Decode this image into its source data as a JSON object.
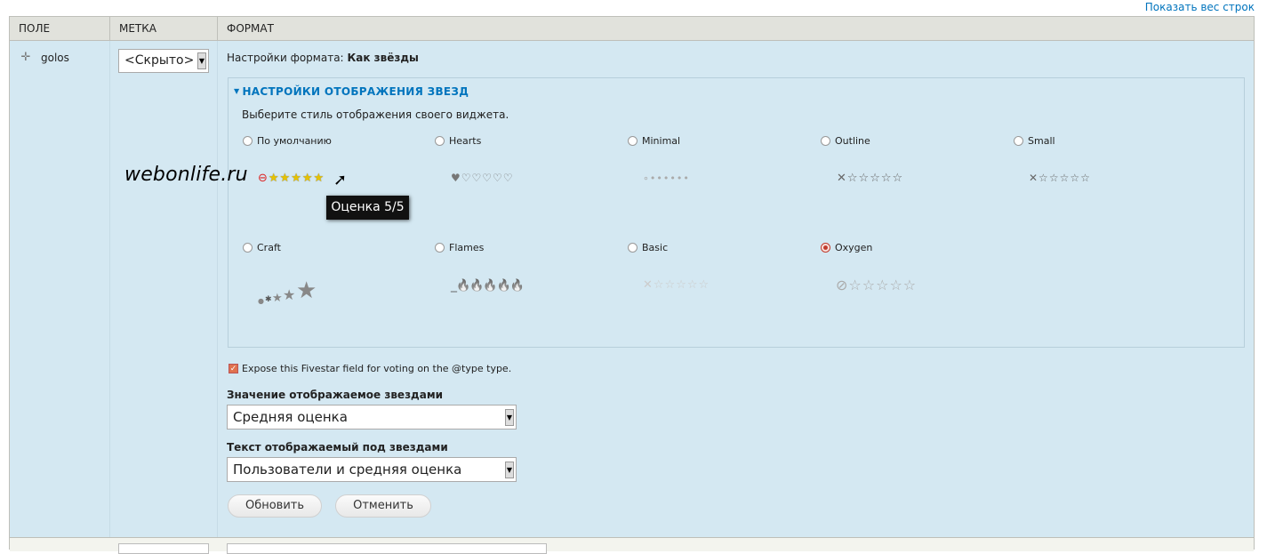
{
  "top_link": "Показать вес строк",
  "columns": [
    "Поле",
    "Метка",
    "Формат"
  ],
  "row": {
    "field": "golos",
    "label_select": "<Скрыто>",
    "format_summary_prefix": "Настройки формата:",
    "format_summary_value": "Как звёзды"
  },
  "fieldset": {
    "legend": "НАСТРОЙКИ ОТОБРАЖЕНИЯ ЗВЕЗД",
    "description": "Выберите стиль отображения своего виджета.",
    "styles": [
      {
        "label": "По умолчанию",
        "selected": false,
        "preview": "⊖★★★★★"
      },
      {
        "label": "Hearts",
        "selected": false,
        "preview": "♥♡♡♡♡♡"
      },
      {
        "label": "Minimal",
        "selected": false,
        "preview": "∘••••••"
      },
      {
        "label": "Outline",
        "selected": false,
        "preview": "✕☆☆☆☆☆"
      },
      {
        "label": "Small",
        "selected": false,
        "preview": "✕☆☆☆☆☆"
      },
      {
        "label": "Craft",
        "selected": false,
        "preview": "•∗★★✸"
      },
      {
        "label": "Flames",
        "selected": false,
        "preview": "_🔥🔥🔥🔥🔥"
      },
      {
        "label": "Basic",
        "selected": false,
        "preview": "✕☆☆☆☆☆"
      },
      {
        "label": "Oxygen",
        "selected": true,
        "preview": "⊘☆☆☆☆☆"
      }
    ]
  },
  "tooltip": "Оценка 5/5",
  "watermark": "webonlife.ru",
  "expose_checkbox": {
    "label": "Expose this Fivestar field for voting on the @type type.",
    "checked": true
  },
  "stars_value": {
    "label": "Значение отображаемое звездами",
    "value": "Средняя оценка"
  },
  "stars_text": {
    "label": "Текст отображаемый под звездами",
    "value": "Пользователи и средняя оценка"
  },
  "buttons": {
    "update": "Обновить",
    "cancel": "Отменить"
  },
  "colors": {
    "link": "#0074bd",
    "row_bg": "#d4e8f2",
    "header_bg": "#e1e2dc",
    "star_fill": "#ffe600",
    "radio_selected": "#c0392b"
  },
  "icons": {
    "drag": "drag-handle-icon",
    "select_arrow": "dropdown-arrow-icon",
    "cursor": "mouse-pointer-icon"
  }
}
